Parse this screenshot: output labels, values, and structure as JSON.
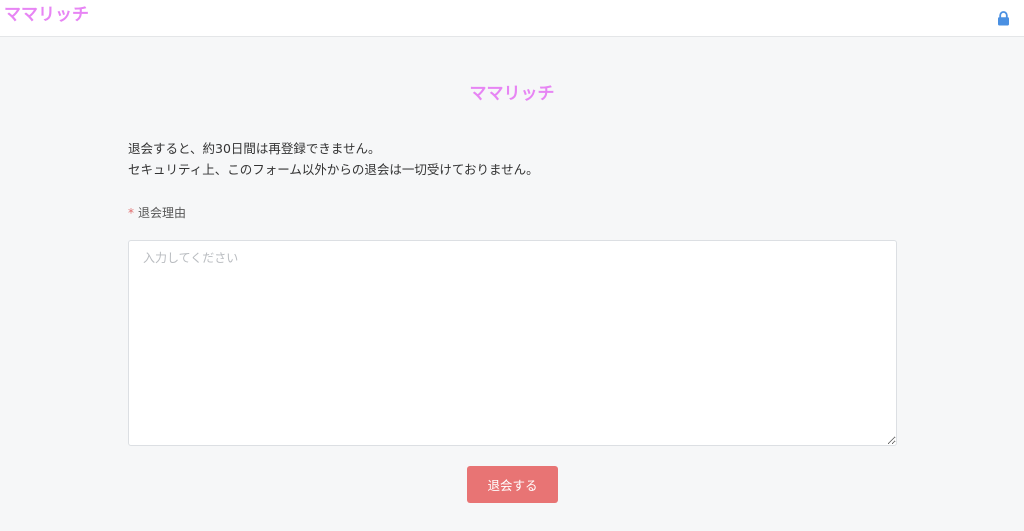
{
  "header": {
    "logo": "ママリッチ",
    "lock_icon": "lock-icon",
    "lock_color": "#4a90e2"
  },
  "main": {
    "title": "ママリッチ",
    "notice_lines": [
      "退会すると、約30日間は再登録できません。",
      "セキュリティ上、このフォーム以外からの退会は一切受けておりません。"
    ],
    "reason_field": {
      "required_mark": "*",
      "label": "退会理由",
      "value": "",
      "placeholder": "入力してください"
    },
    "submit_label": "退会する"
  },
  "colors": {
    "brand": "#e785f4",
    "danger": "#e87474",
    "background": "#f6f7f8"
  }
}
